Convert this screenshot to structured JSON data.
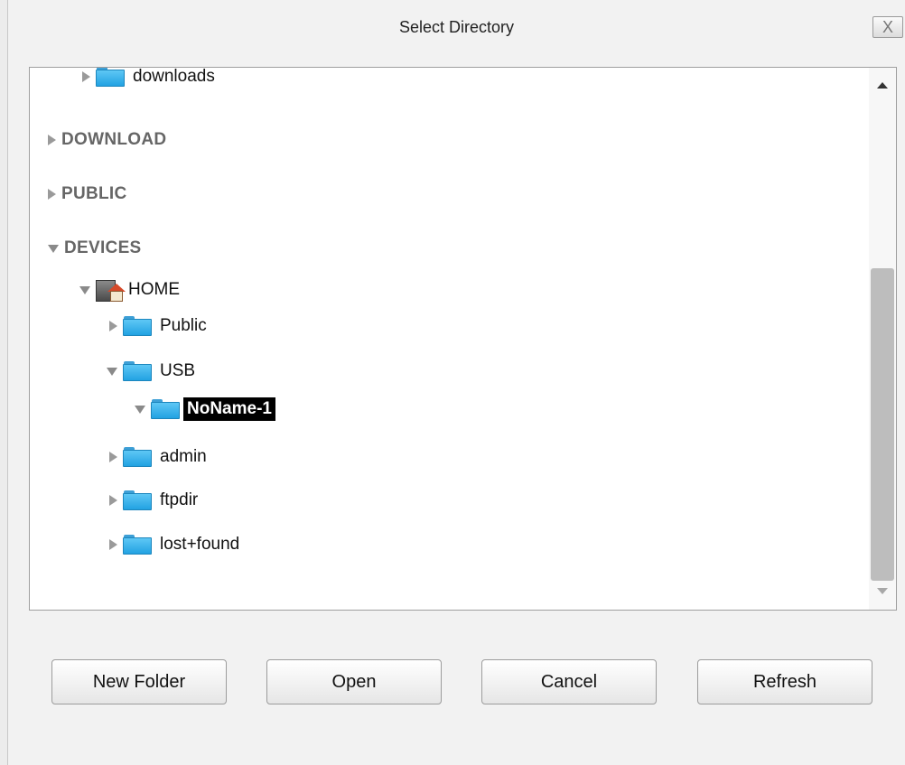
{
  "window": {
    "title": "Select Directory",
    "close_glyph": "X"
  },
  "tree": {
    "downloads": "downloads",
    "download_section": "DOWNLOAD",
    "public_section": "PUBLIC",
    "devices_section": "DEVICES",
    "home": "HOME",
    "public": "Public",
    "usb": "USB",
    "noname": "NoName-1",
    "admin": "admin",
    "ftpdir": "ftpdir",
    "lost_found": "lost+found"
  },
  "buttons": {
    "new_folder": "New Folder",
    "open": "Open",
    "cancel": "Cancel",
    "refresh": "Refresh"
  },
  "selected_item": "NoName-1",
  "icons": [
    "folder-icon",
    "home-drive-icon",
    "expand-arrow-icon",
    "collapse-arrow-icon",
    "close-icon"
  ]
}
